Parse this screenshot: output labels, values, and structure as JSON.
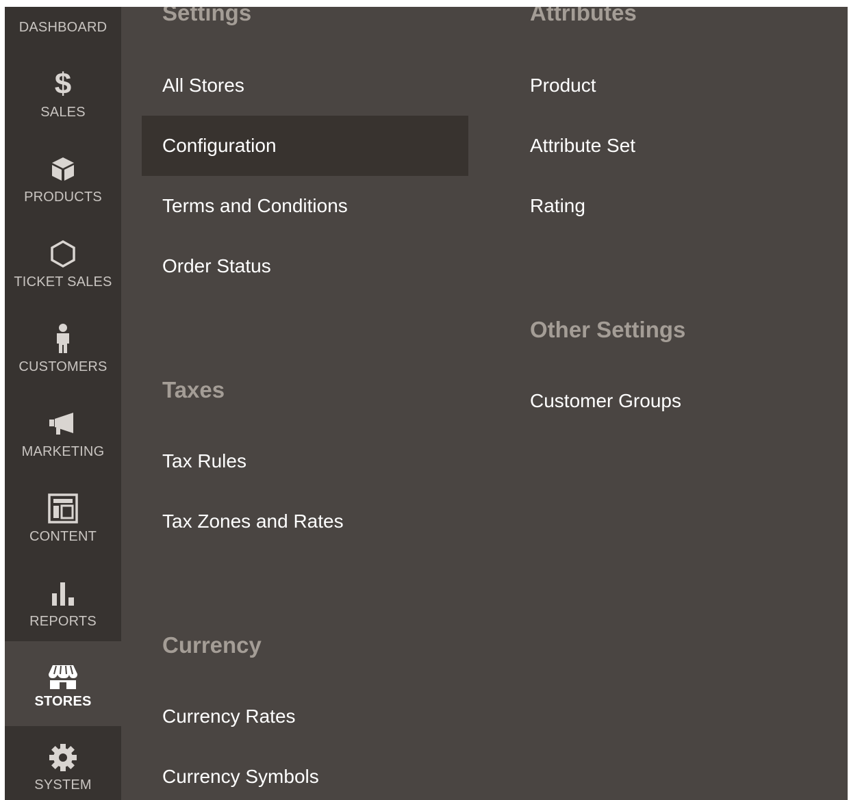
{
  "sidebar": {
    "items": [
      {
        "label": "DASHBOARD",
        "icon": "dashboard-icon"
      },
      {
        "label": "SALES",
        "icon": "dollar-icon"
      },
      {
        "label": "PRODUCTS",
        "icon": "box-icon"
      },
      {
        "label": "TICKET SALES",
        "icon": "hexagon-icon"
      },
      {
        "label": "CUSTOMERS",
        "icon": "person-icon"
      },
      {
        "label": "MARKETING",
        "icon": "megaphone-icon"
      },
      {
        "label": "CONTENT",
        "icon": "layout-icon"
      },
      {
        "label": "REPORTS",
        "icon": "bar-chart-icon"
      },
      {
        "label": "STORES",
        "icon": "storefront-icon",
        "active": true
      },
      {
        "label": "SYSTEM",
        "icon": "gear-icon"
      }
    ]
  },
  "submenu": {
    "settings": {
      "title": "Settings",
      "items": [
        "All Stores",
        "Configuration",
        "Terms and Conditions",
        "Order Status"
      ],
      "highlighted": "Configuration"
    },
    "taxes": {
      "title": "Taxes",
      "items": [
        "Tax Rules",
        "Tax Zones and Rates"
      ]
    },
    "currency": {
      "title": "Currency",
      "items": [
        "Currency Rates",
        "Currency Symbols"
      ]
    },
    "attributes": {
      "title": "Attributes",
      "items": [
        "Product",
        "Attribute Set",
        "Rating"
      ]
    },
    "other_settings": {
      "title": "Other Settings",
      "items": [
        "Customer Groups"
      ]
    }
  },
  "colors": {
    "sidebar_bg": "#373330",
    "panel_bg": "#4a4542",
    "highlight_bg": "#38332f",
    "group_title": "#a49d96",
    "link_text": "#ffffff"
  }
}
